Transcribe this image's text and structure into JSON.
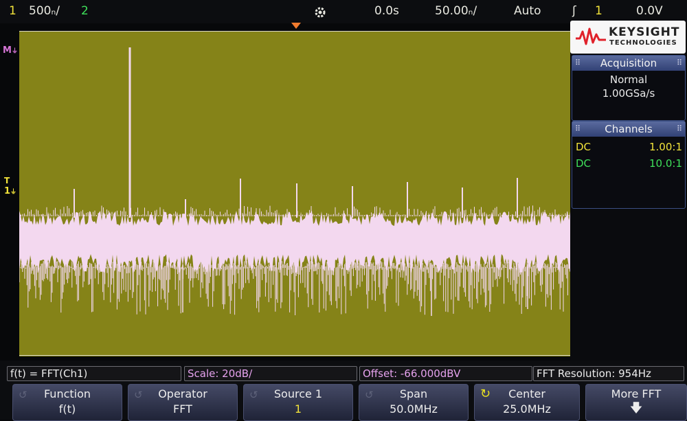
{
  "top": {
    "ch1_label": "1",
    "ch1_scale": "500ₙ/",
    "ch2_label": "2",
    "delay": "0.0s",
    "timebase": "50.00ₙ/",
    "trig_mode": "Auto",
    "trig_edge_icon": "ʃ",
    "trig_source": "1",
    "trig_level": "0.0V"
  },
  "brand": {
    "name": "KEYSIGHT",
    "sub": "TECHNOLOGIES"
  },
  "acquisition": {
    "title": "Acquisition",
    "mode": "Normal",
    "rate": "1.00GSa/s"
  },
  "channels": {
    "title": "Channels",
    "rows": [
      {
        "coupling": "DC",
        "ratio": "1.00:1",
        "color": "#f2e33a"
      },
      {
        "coupling": "DC",
        "ratio": "10.0:1",
        "color": "#3fe05a"
      }
    ]
  },
  "markers": {
    "math": "M",
    "trigger": "T",
    "ch1": "1"
  },
  "status": {
    "function": "f(t) = FFT(Ch1)",
    "scale": "Scale: 20dB/",
    "offset": "Offset: -66.000dBV",
    "resolution": "FFT Resolution: 954Hz"
  },
  "softkeys": [
    {
      "key": "Function",
      "value": "f(t)"
    },
    {
      "key": "Operator",
      "value": "FFT"
    },
    {
      "key": "Source 1",
      "value": "1"
    },
    {
      "key": "Span",
      "value": "50.0MHz"
    },
    {
      "key": "Center",
      "value": "25.0MHz"
    },
    {
      "key": "More FFT",
      "value": ""
    }
  ],
  "colors": {
    "screen_bg": "#858318",
    "trace": "#f3d8ef",
    "ch1": "#f2e33a",
    "ch2": "#3fe05a",
    "math": "#d776d8",
    "trigger": "#f07b2e"
  }
}
